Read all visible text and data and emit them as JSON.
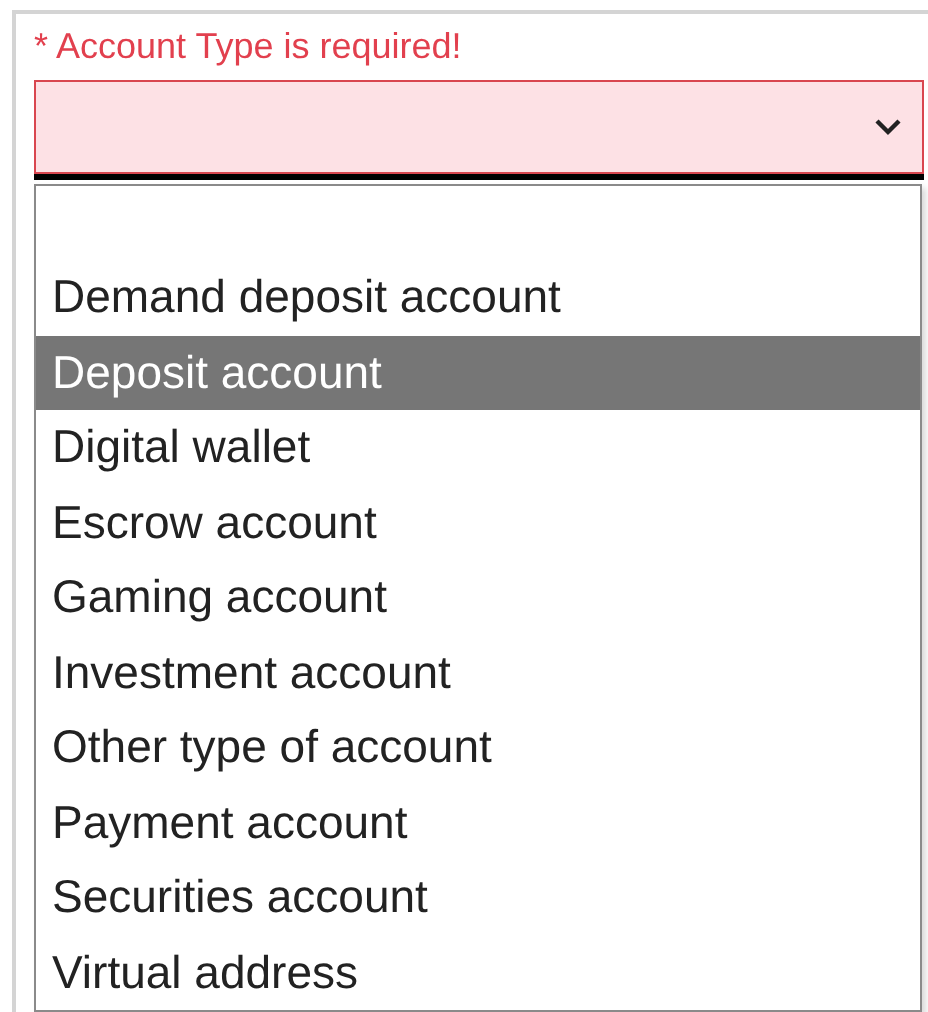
{
  "error": "* Account Type is required!",
  "select": {
    "invalid": true,
    "expanded": true
  },
  "options": [
    {
      "label": "Demand deposit account",
      "selected": false
    },
    {
      "label": "Deposit account",
      "selected": true
    },
    {
      "label": "Digital wallet",
      "selected": false
    },
    {
      "label": "Escrow account",
      "selected": false
    },
    {
      "label": "Gaming account",
      "selected": false
    },
    {
      "label": "Investment account",
      "selected": false
    },
    {
      "label": "Other type of account",
      "selected": false
    },
    {
      "label": "Payment account",
      "selected": false
    },
    {
      "label": "Securities account",
      "selected": false
    },
    {
      "label": "Virtual address",
      "selected": false
    }
  ]
}
